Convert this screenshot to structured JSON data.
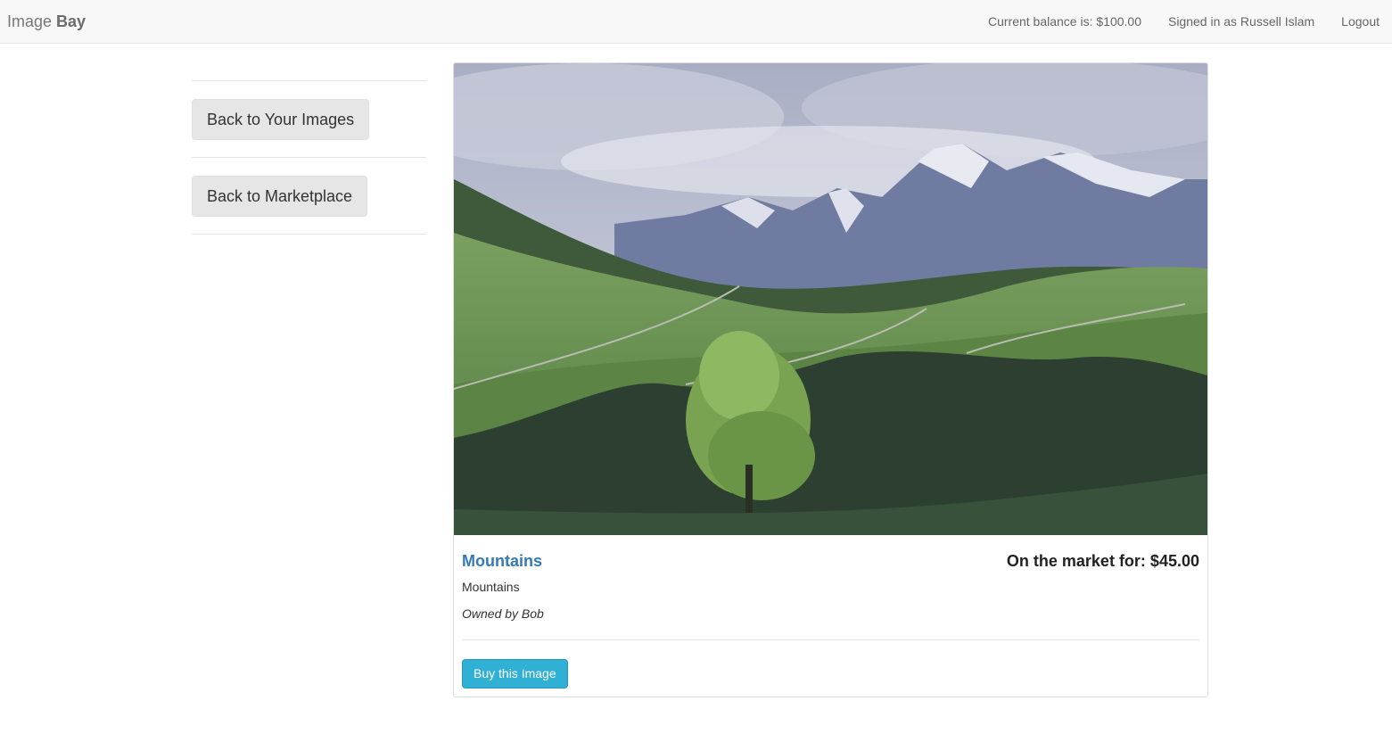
{
  "navbar": {
    "brand_light": "Image",
    "brand_bold": "Bay",
    "balance": "Current balance is: $100.00",
    "signed_in": "Signed in as Russell Islam",
    "logout": "Logout"
  },
  "sidebar": {
    "items": [
      {
        "label": "Back to Your Images"
      },
      {
        "label": "Back to Marketplace"
      }
    ]
  },
  "image_card": {
    "title": "Mountains",
    "price_text": "On the market for: $45.00",
    "description": "Mountains",
    "owner": "Owned by Bob",
    "buy_label": "Buy this Image"
  },
  "colors": {
    "link": "#337ab7",
    "buy_button": "#31b0d5",
    "navbar_bg": "#f8f8f8"
  }
}
